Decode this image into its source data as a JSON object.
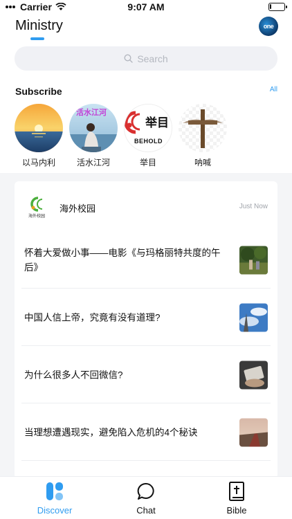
{
  "status_bar": {
    "carrier": "Carrier",
    "time": "9:07 AM",
    "battery_level": 0.1
  },
  "header": {
    "title": "Ministry",
    "avatar_text": "one"
  },
  "search": {
    "placeholder": "Search"
  },
  "subscribe": {
    "title": "Subscribe",
    "all_label": "All",
    "channels": [
      {
        "label": "以马内利",
        "image": "sunset-lake"
      },
      {
        "label": "活水江河",
        "image": "woman-by-water",
        "overlay_text": "活水江河"
      },
      {
        "label": "举目",
        "image": "behold-logo",
        "logo_text": "BEHOLD",
        "logo_cjk": "举目"
      },
      {
        "label": "呐喊",
        "image": "wooden-cross"
      }
    ]
  },
  "feed": {
    "source": {
      "name": "海外校园",
      "time": "Just Now",
      "logo_caption": "海外校园"
    },
    "articles": [
      {
        "title": "怀着大爱做小事——电影《与玛格丽特共度的午后》",
        "thumb": "park-scene"
      },
      {
        "title": "中国人信上帝，究竟有没有道理?",
        "thumb": "tower-sky"
      },
      {
        "title": "为什么很多人不回微信?",
        "thumb": "phone-hand"
      },
      {
        "title": "当理想遭遇现实，避免陷入危机的4个秘诀",
        "thumb": "road-sunset"
      }
    ]
  },
  "tabs": [
    {
      "label": "Discover",
      "icon": "discover-icon",
      "active": true
    },
    {
      "label": "Chat",
      "icon": "chat-bubble-icon",
      "active": false
    },
    {
      "label": "Bible",
      "icon": "bible-book-icon",
      "active": false
    }
  ],
  "colors": {
    "accent": "#2f9cf0",
    "background": "#f4f5f7",
    "search_bg": "#f0f1f5"
  }
}
